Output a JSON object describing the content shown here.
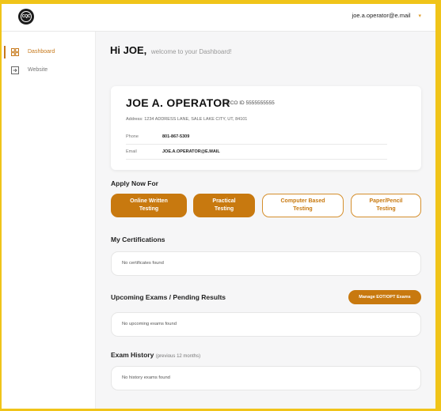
{
  "header": {
    "logo_text": "CQC",
    "user_email": "joe.a.operator@e.mail",
    "caret": "▾"
  },
  "sidebar": {
    "items": [
      {
        "label": "Dashboard",
        "icon": "grid-icon",
        "active": true
      },
      {
        "label": "Website",
        "icon": "external-link-icon",
        "active": false
      }
    ]
  },
  "greeting": {
    "hi": "Hi JOE,",
    "sub": "welcome to your Dashboard!"
  },
  "profile": {
    "name": "JOE A. OPERATOR",
    "id_label": "CCO ID 5555555555",
    "address": "Address: 1234 ADDRESS LANE, SALE LAKE CITY, UT, 84101",
    "phone_label": "Phone",
    "phone": "801-867-5309",
    "email_label": "Email",
    "email": "JOE.A.OPERATOR@E.MAIL"
  },
  "apply": {
    "title": "Apply Now For",
    "buttons": [
      {
        "label": "Online Written\nTesting",
        "style": "filled"
      },
      {
        "label": "Practical\nTesting",
        "style": "filled"
      },
      {
        "label": "Computer Based\nTesting",
        "style": "outline"
      },
      {
        "label": "Paper/Pencil\nTesting",
        "style": "outline"
      }
    ]
  },
  "certifications": {
    "title": "My Certifications",
    "empty": "No certificates found"
  },
  "upcoming": {
    "title": "Upcoming Exams / Pending Results",
    "manage_label": "Manage EOT/OPT Exams",
    "empty": "No upcoming exams found"
  },
  "history": {
    "title": "Exam History",
    "note": "(previous 12 months)",
    "empty": "No history exams found"
  },
  "colors": {
    "accent": "#c8790f",
    "frame": "#f0c419"
  }
}
